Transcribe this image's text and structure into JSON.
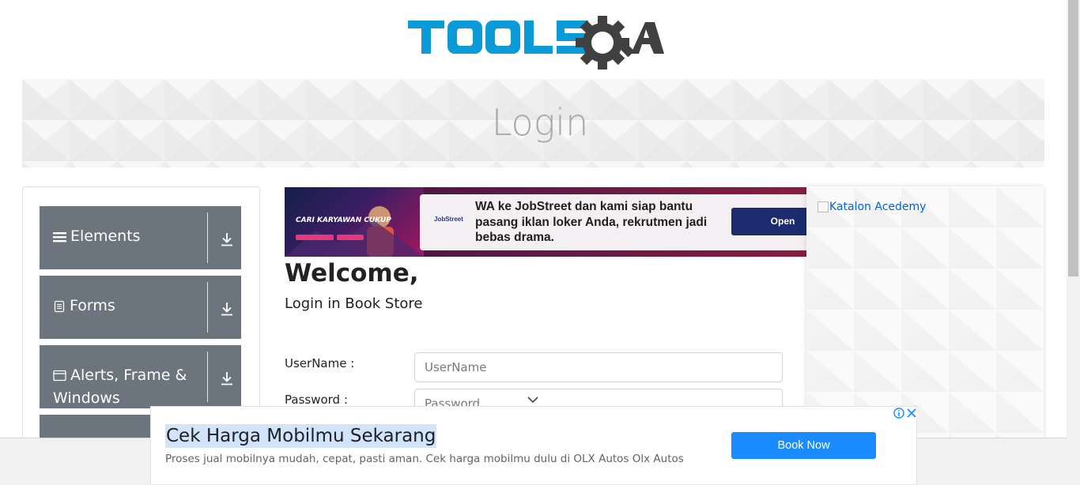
{
  "logo": {
    "text": "TOOLSQA",
    "primary_color": "#0a9bd8",
    "secondary_color": "#404040"
  },
  "banner": {
    "title": "Login",
    "bg_color": "#f3f3f3"
  },
  "sidebar": {
    "groups": [
      {
        "icon": "menu-icon",
        "label": "Elements"
      },
      {
        "icon": "document-icon",
        "label": "Forms"
      },
      {
        "icon": "window-icon",
        "label": "Alerts, Frame &",
        "label_line2": "Windows"
      }
    ],
    "group_bg": "#6c757d"
  },
  "ad_top": {
    "poster_headline": "CARI KARYAWAN CUKUP",
    "brand": "JobStreet",
    "message": "WA ke JobStreet dan kami siap bantu pasang iklan loker Anda, rekrutmen jadi bebas drama.",
    "button": "Open"
  },
  "main": {
    "welcome": "Welcome,",
    "subtitle": "Login in Book Store",
    "username_label": "UserName :",
    "username_placeholder": "UserName",
    "password_label": "Password :",
    "password_placeholder": "Password"
  },
  "right_ad": {
    "alt_text": "Katalon Acedemy"
  },
  "bottom_ad": {
    "headline": "Cek Harga Mobilmu Sekarang",
    "description": "Proses jual mobilnya mudah, cepat, pasti aman. Cek harga mobilmu dulu di OLX Autos Olx Autos",
    "button": "Book Now",
    "button_color": "#1a8cff"
  }
}
